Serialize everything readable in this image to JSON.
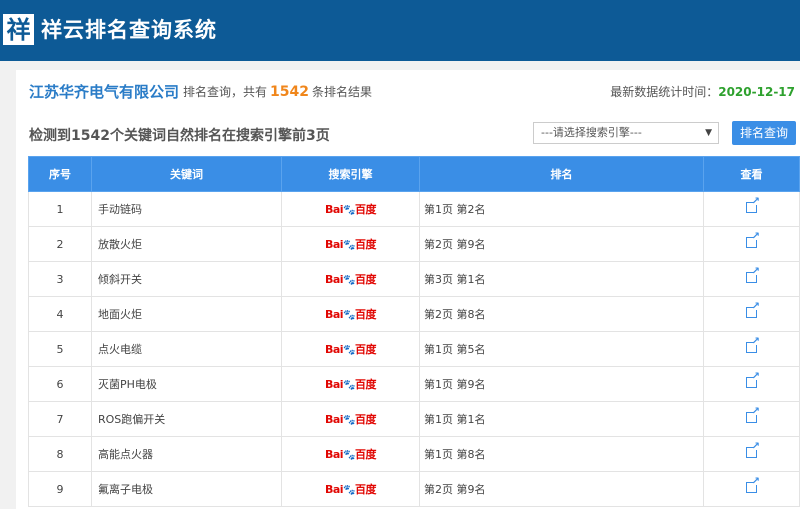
{
  "header": {
    "logo_char": "祥",
    "title": "祥云排名查询系统"
  },
  "info": {
    "company": "江苏华齐电气有限公司",
    "summary_prefix": "排名查询，共有",
    "count": "1542",
    "summary_suffix": "条排名结果",
    "time_label": "最新数据统计时间：",
    "time_value": "2020-12-17"
  },
  "toolbar": {
    "detect_text": "检测到1542个关键词自然排名在搜索引擎前3页",
    "select_placeholder": "---请选择搜索引擎---",
    "search_button": "排名查询"
  },
  "table": {
    "headers": [
      "序号",
      "关键词",
      "搜索引擎",
      "排名",
      "查看"
    ],
    "engine": {
      "bai": "Bai",
      "paw": "🐾",
      "du": "百度",
      "icon": "baidu-logo"
    },
    "rows": [
      {
        "num": "1",
        "keyword": "手动链码",
        "rank": "第1页 第2名"
      },
      {
        "num": "2",
        "keyword": "放散火炬",
        "rank": "第2页 第9名"
      },
      {
        "num": "3",
        "keyword": "倾斜开关",
        "rank": "第3页 第1名"
      },
      {
        "num": "4",
        "keyword": "地面火炬",
        "rank": "第2页 第8名"
      },
      {
        "num": "5",
        "keyword": "点火电缆",
        "rank": "第1页 第5名"
      },
      {
        "num": "6",
        "keyword": "灭菌PH电极",
        "rank": "第1页 第9名"
      },
      {
        "num": "7",
        "keyword": "ROS跑偏开关",
        "rank": "第1页 第1名"
      },
      {
        "num": "8",
        "keyword": "高能点火器",
        "rank": "第1页 第8名"
      },
      {
        "num": "9",
        "keyword": "氟离子电极",
        "rank": "第2页 第9名"
      }
    ]
  },
  "colors": {
    "topbar": "#0d5a96",
    "accent": "#3a8ee6",
    "count": "#f0861b",
    "date": "#2ea12e"
  }
}
